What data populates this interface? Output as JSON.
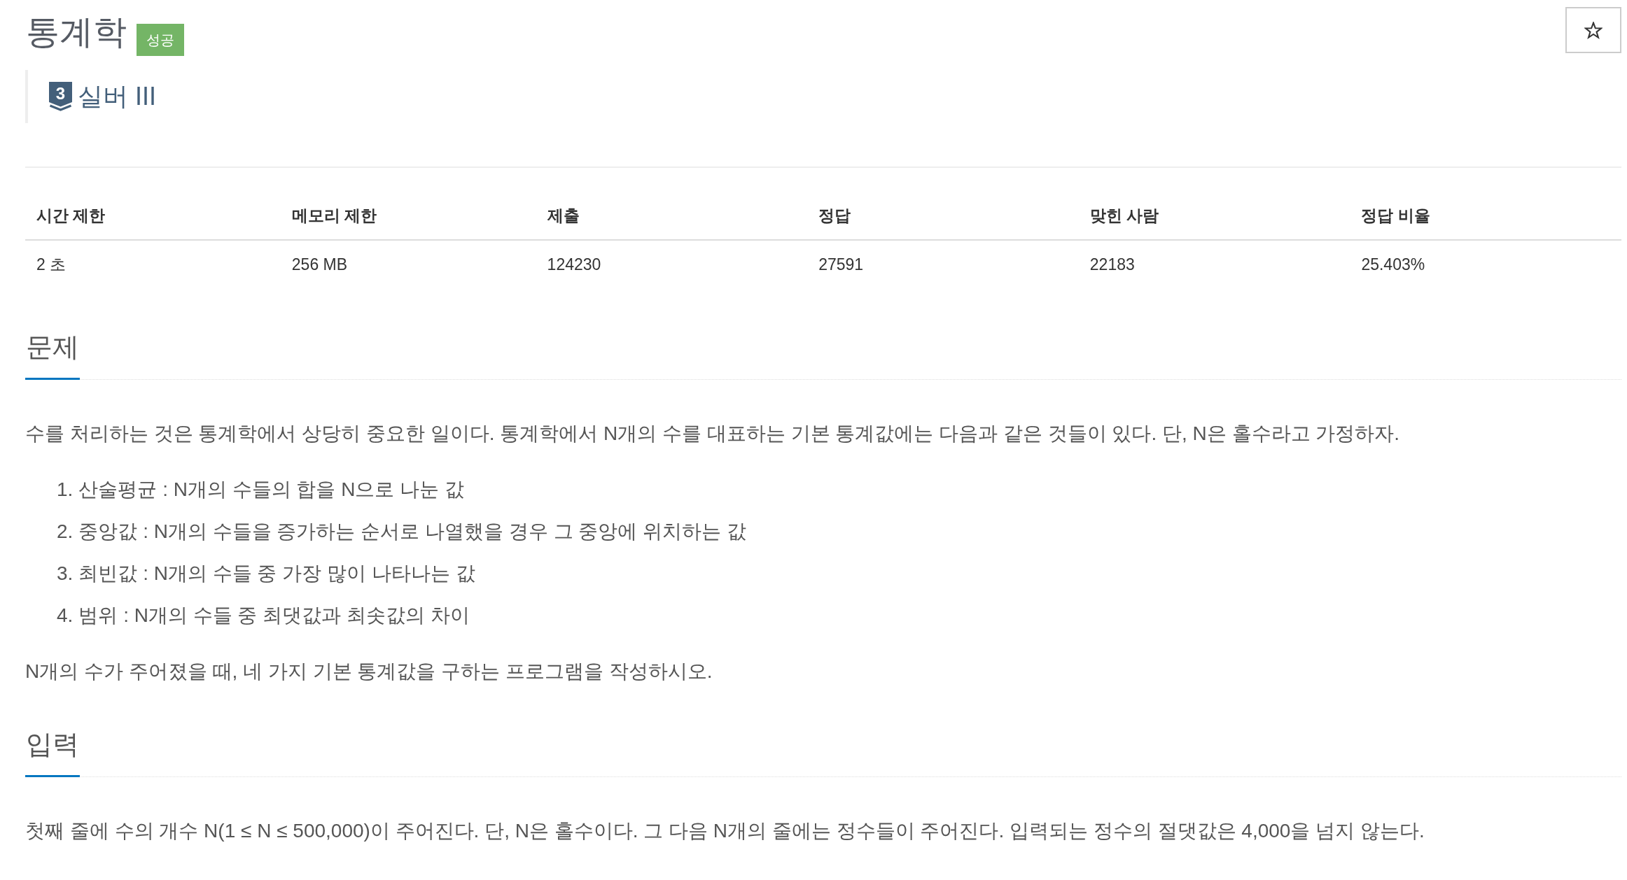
{
  "problem": {
    "title": "통계학",
    "result_badge": "성공",
    "tier": {
      "number": "3",
      "label": "실버 III"
    },
    "starred": false
  },
  "stats": {
    "columns": [
      "시간 제한",
      "메모리 제한",
      "제출",
      "정답",
      "맞힌 사람",
      "정답 비율"
    ],
    "rows": [
      [
        "2 초",
        "256 MB",
        "124230",
        "27591",
        "22183",
        "25.403%"
      ]
    ]
  },
  "sections": [
    {
      "heading": "문제",
      "blocks": [
        {
          "kind": "paragraph",
          "text": "수를 처리하는 것은 통계학에서 상당히 중요한 일이다. 통계학에서 N개의 수를 대표하는 기본 통계값에는 다음과 같은 것들이 있다. 단, N은 홀수라고 가정하자."
        },
        {
          "kind": "ordered_list",
          "items": [
            {
              "number": "1.",
              "text": "산술평균 : N개의 수들의 합을 N으로 나눈 값"
            },
            {
              "number": "2.",
              "text": "중앙값 : N개의 수들을 증가하는 순서로 나열했을 경우 그 중앙에 위치하는 값"
            },
            {
              "number": "3.",
              "text": "최빈값 : N개의 수들 중 가장 많이 나타나는 값"
            },
            {
              "number": "4.",
              "text": "범위 : N개의 수들 중 최댓값과 최솟값의 차이"
            }
          ]
        },
        {
          "kind": "paragraph",
          "text": "N개의 수가 주어졌을 때, 네 가지 기본 통계값을 구하는 프로그램을 작성하시오."
        }
      ]
    },
    {
      "heading": "입력",
      "blocks": [
        {
          "kind": "paragraph",
          "text": "첫째 줄에 수의 개수 N(1 ≤ N ≤ 500,000)이 주어진다. 단, N은 홀수이다. 그 다음 N개의 줄에는 정수들이 주어진다. 입력되는 정수의 절댓값은 4,000을 넘지 않는다."
        }
      ]
    }
  ]
}
